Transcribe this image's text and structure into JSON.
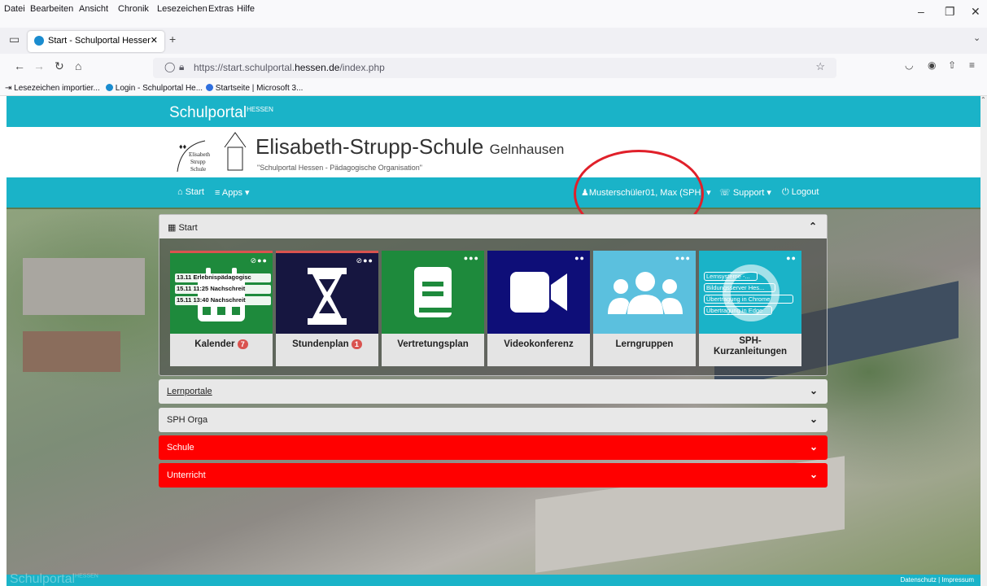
{
  "menu": {
    "items": [
      "Datei",
      "Bearbeiten",
      "Ansicht",
      "Chronik",
      "Lesezeichen",
      "Extras",
      "Hilfe"
    ]
  },
  "tab": {
    "title": "Start - Schulportal Hessen - Päd"
  },
  "url": {
    "prefix": "https://start.schulportal.",
    "domain": "hessen.de",
    "path": "/index.php"
  },
  "bookmarks": [
    "Lesezeichen importier...",
    "Login - Schulportal He...",
    "Startseite | Microsoft 3..."
  ],
  "site": {
    "brand": "Schulportal",
    "brand_sup": "HESSEN",
    "school_name": "Elisabeth-Strupp-Schule",
    "school_city": "Gelnhausen",
    "school_sub": "\"Schulportal Hessen - Pädagogische Organisation\"",
    "logo_text": [
      "Elisabeth",
      "Strupp",
      "Schule"
    ]
  },
  "nav": {
    "start": "Start",
    "apps": "Apps",
    "user": "Musterschüler01, Max (SPH)",
    "support": "Support",
    "logout": "Logout"
  },
  "start_panel": {
    "title": "Start"
  },
  "tiles": [
    {
      "label": "Kalender",
      "count": "7",
      "color": "#1e8a3c"
    },
    {
      "label": "Stundenplan",
      "count": "1",
      "color": "#161640"
    },
    {
      "label": "Vertretungsplan",
      "color": "#1e8a3c"
    },
    {
      "label": "Videokonferenz",
      "color": "#0e0e78"
    },
    {
      "label": "Lerngruppen",
      "color": "#5bc0de"
    },
    {
      "label": "SPH-\nKurzanleitungen",
      "color": "#1ab3c8"
    }
  ],
  "calendar_events": [
    {
      "date": "13.11",
      "text": "Erlebnispädagogisc"
    },
    {
      "date": "15.11",
      "time": "11:25",
      "text": "Nachschreit"
    },
    {
      "date": "15.11",
      "time": "13:40",
      "text": "Nachschreit"
    }
  ],
  "guide_links": [
    "Lernsysteme -...",
    "Bildungsserver Hes...",
    "Übertragung in Chrome",
    "Übertragung in Edge"
  ],
  "panels": [
    {
      "title": "Lernportale"
    },
    {
      "title": "SPH Orga"
    },
    {
      "title": "Schule"
    },
    {
      "title": "Unterricht"
    }
  ],
  "footer": {
    "brand": "Schulportal",
    "brand_sup": "HESSEN",
    "links": "Datenschutz | Impressum"
  },
  "colors": {
    "brand": "#1ab3c8",
    "red_panel": "#ff0000",
    "annotation": "#e0202a"
  }
}
